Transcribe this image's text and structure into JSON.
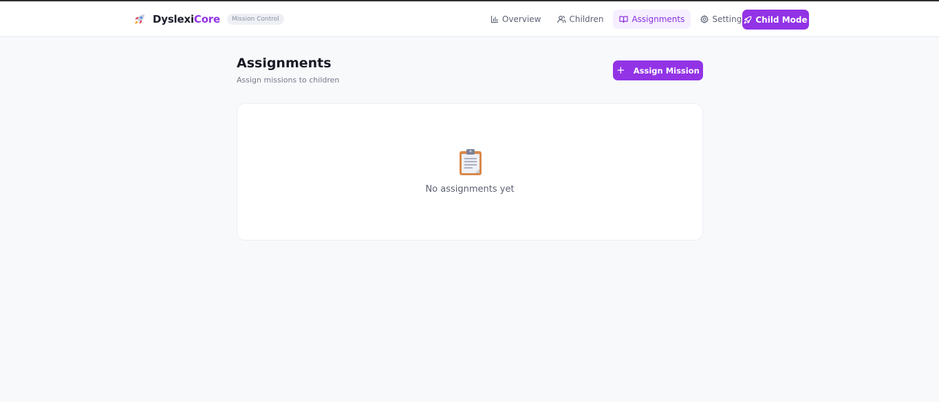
{
  "header": {
    "brand": {
      "name_part1": "Dyslexi",
      "name_part2": "Core",
      "badge": "Mission Control",
      "icon": "rocket-icon"
    },
    "nav": [
      {
        "label": "Overview",
        "icon": "bar-chart-icon",
        "active": false
      },
      {
        "label": "Children",
        "icon": "users-icon",
        "active": false
      },
      {
        "label": "Assignments",
        "icon": "book-open-icon",
        "active": true
      },
      {
        "label": "Settings",
        "icon": "gear-icon",
        "active": false
      }
    ],
    "child_mode_label": "Child Mode"
  },
  "main": {
    "title": "Assignments",
    "subtitle": "Assign missions to children",
    "assign_button_label": "Assign Mission",
    "empty_state": {
      "icon": "clipboard-icon",
      "text": "No assignments yet"
    }
  },
  "colors": {
    "accent": "#9233e6",
    "background": "#f8f9fb",
    "active_nav_bg": "#f5efff"
  }
}
